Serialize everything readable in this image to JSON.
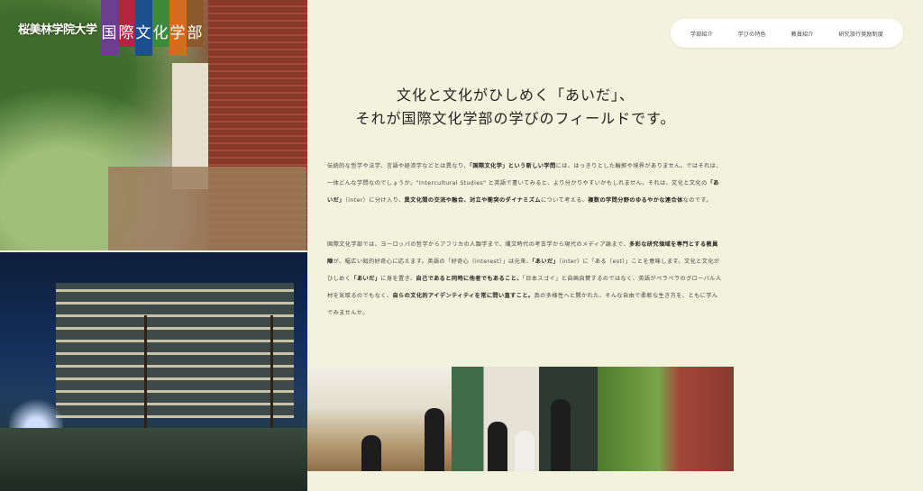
{
  "logo": {
    "school": "桜美林学院大学",
    "department_chars": [
      "国",
      "際",
      "文",
      "化",
      "学",
      "部"
    ],
    "bar_colors": [
      "#6b3e8e",
      "#b5243f",
      "#1c4f8f",
      "#3e8a3c",
      "#d46b1e",
      "#8a5a2a"
    ]
  },
  "nav": {
    "items": [
      "学部紹介",
      "学びの特色",
      "教員紹介",
      "研究旅行奨励制度"
    ]
  },
  "heading": {
    "line1": "文化と文化がひしめく「あいだ」、",
    "line2": "それが国際文化学部の学びのフィールドです。"
  },
  "paragraph1": {
    "t1": "伝統的な哲学や法学、言語や経済学などとは異なり、",
    "b1": "「国際文化学」という新しい学問",
    "t2": "には、はっきりとした輪郭や境界がありません。ではそれは、一体どんな学問なのでしょうか。\"Intercultural Studies\" と英語で書いてみると、より分かりやすいかもしれません。それは、文化と文化の",
    "b2": "「あいだ」",
    "t3": "（inter）に分け入り、",
    "b3": "異文化間の交流や融合、対立や衝突のダイナミズム",
    "t4": "について考える、",
    "b4": "複数の学問分野のゆるやかな連合体",
    "t5": "なのです。"
  },
  "paragraph2": {
    "t1": "国際文化学部では、ヨーロッパの哲学からアフリカの人類学まで、縄文時代の考古学から現代のメディア論まで、",
    "b1": "多彩な研究領域を専門とする教員陣",
    "t2": "が、幅広い知的好奇心に応えます。英語の「好奇心（interest）」は元来、",
    "b2": "「あいだ」",
    "t3": "（inter）に「ある（est）」ことを意味します。文化と文化がひしめく",
    "b3": "「あいだ」",
    "t4": "に身を置き、",
    "b4": "自己であると同時に他者でもあること、",
    "t5": "「日本スゴイ」と自画自賛するのではなく、英語がペラペラのグローバル人材を気取るのでもなく、",
    "b5": "自らの文化的アイデンティティを常に問い直すこと。",
    "t6": "真の多様性へと開かれた、そんな自由で柔軟な生き方を、ともに学んでみませんか。"
  }
}
